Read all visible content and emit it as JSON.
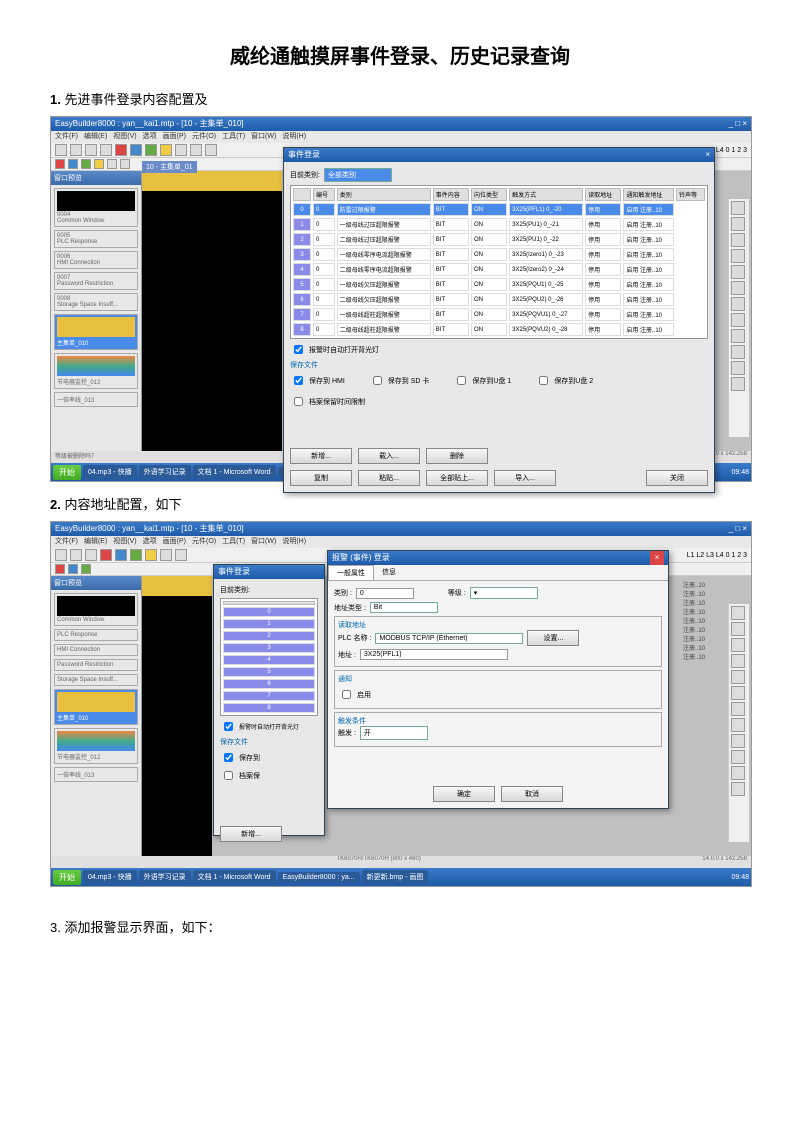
{
  "doc": {
    "title": "威纶通触摸屏事件登录、历史记录查询",
    "step1": "先进事件登录内容配置及",
    "step2": "内容地址配置，如下",
    "step3": "添加报警显示界面，如下："
  },
  "app": {
    "title": "EasyBuilder8000 : yan__kai1.mtp - [10 - 主集单_010]",
    "menus": [
      "文件(F)",
      "编辑(E)",
      "视图(V)",
      "选项",
      "画面(P)",
      "元件(O)",
      "工具(T)",
      "窗口(W)",
      "说明(H)"
    ],
    "panelTitle": "窗口预览",
    "sidebarItems": [
      {
        "id": "0004",
        "label": "Common Window"
      },
      {
        "id": "0005",
        "label": "PLC Response"
      },
      {
        "id": "0006",
        "label": "HMI Connection"
      },
      {
        "id": "0007",
        "label": "Password Restriction"
      },
      {
        "id": "0008",
        "label": "Storage Space Insuff..."
      },
      {
        "id": "0010",
        "label": "主集单_010"
      },
      {
        "id": "0011",
        "label": "节电器监控_012"
      },
      {
        "id": "0012",
        "label": "一倍率线_013"
      }
    ],
    "editorTab": "10 - 主集单_01"
  },
  "dialog1": {
    "title": "事件登录",
    "catLabel": "目前类别:",
    "catValue": "全部类别",
    "cols": [
      "编号",
      "类别",
      "事件内容",
      "向位类型",
      "触发方式",
      "读取地址",
      "通知触发地址",
      "铃声等"
    ],
    "rows": [
      {
        "n": "0",
        "c": "0",
        "t": "防雷过限报警",
        "bt": "BIT",
        "tm": "ON",
        "a": "3X25(PFL1) 0_-20",
        "p": "停用",
        "s": "启用 注册..10"
      },
      {
        "n": "1",
        "c": "0",
        "t": "一级母线过压超限报警",
        "bt": "BIT",
        "tm": "ON",
        "a": "3X25(PU1) 0_-21",
        "p": "停用",
        "s": "启用 注册..10"
      },
      {
        "n": "2",
        "c": "0",
        "t": "二级母线过压超限报警",
        "bt": "BIT",
        "tm": "ON",
        "a": "3X25(PU1) 0_-22",
        "p": "停用",
        "s": "启用 注册..10"
      },
      {
        "n": "3",
        "c": "0",
        "t": "一级母线零序电流超限报警",
        "bt": "BIT",
        "tm": "ON",
        "a": "3X25(Izero1) 0_-23",
        "p": "停用",
        "s": "启用 注册..10"
      },
      {
        "n": "4",
        "c": "0",
        "t": "二级母线零序电流超限报警",
        "bt": "BIT",
        "tm": "ON",
        "a": "3X25(Izero2) 0_-24",
        "p": "停用",
        "s": "启用 注册..10"
      },
      {
        "n": "5",
        "c": "0",
        "t": "一级母线欠压超限报警",
        "bt": "BIT",
        "tm": "ON",
        "a": "3X25(PQU1) 0_-25",
        "p": "停用",
        "s": "启用 注册..10"
      },
      {
        "n": "6",
        "c": "0",
        "t": "二级母线欠压超限报警",
        "bt": "BIT",
        "tm": "ON",
        "a": "3X25(PQU2) 0_-26",
        "p": "停用",
        "s": "启用 注册..10"
      },
      {
        "n": "7",
        "c": "0",
        "t": "一级母线超柱超限报警",
        "bt": "BIT",
        "tm": "ON",
        "a": "3X25(PQVU1) 0_-27",
        "p": "停用",
        "s": "启用 注册..10"
      },
      {
        "n": "8",
        "c": "0",
        "t": "二级母线超柱超限报警",
        "bt": "BIT",
        "tm": "ON",
        "a": "3X25(PQVU2) 0_-28",
        "p": "停用",
        "s": "启用 注册..10"
      }
    ],
    "chkBacklight": "报警时自动打开背光灯",
    "saveLabel": "保存文件",
    "chkHMI": "保存到 HMI",
    "chkSD": "保存到 SD 卡",
    "chkUSB1": "保存到U盘 1",
    "chkUSB2": "保存到U盘 2",
    "chkLimit": "档案保留时间限制",
    "btns": {
      "new": "新增...",
      "ins": "载入...",
      "del": "删除",
      "copy": "复制",
      "paste": "粘贴...",
      "all": "全部贴上...",
      "export": "导入...",
      "close": "关闭"
    }
  },
  "dialog2": {
    "title": "报警 (事件) 登录",
    "tab1": "一般属性",
    "tab2": "信息",
    "catLabel": "类别 :",
    "catVal": "0",
    "prioLabel": "等级 :",
    "addrTypeLabel": "地址类型 :",
    "addrTypeVal": "Bit",
    "readGroup": "读取地址",
    "plcLabel": "PLC 名称 :",
    "plcVal": "MODBUS TCP/IP (Ethernet)",
    "plcBtn": "设置...",
    "addrLabel": "地址 :",
    "addrVal": "3X25(PFL1)",
    "notifyGroup": "通知",
    "enableLabel": "启用",
    "trigGroup": "触发条件",
    "trigLabel": "触发 :",
    "trigVal": "开",
    "ok": "确定",
    "cancel": "取消"
  },
  "taskbar": {
    "start": "开始",
    "t1": "04.mp3 - 快播",
    "t2": "外语学习记录",
    "t3": "文档 1 - Microsoft Word",
    "t4": "EasyBuilder8000 : ya...",
    "t5": "新更新.bmp - 画图",
    "time": "09:48"
  },
  "status": {
    "left": "等级被删除吗？",
    "center": "TK6070H/TK6070H (800 x 480)",
    "right": "14.0.0 x 142.258"
  }
}
